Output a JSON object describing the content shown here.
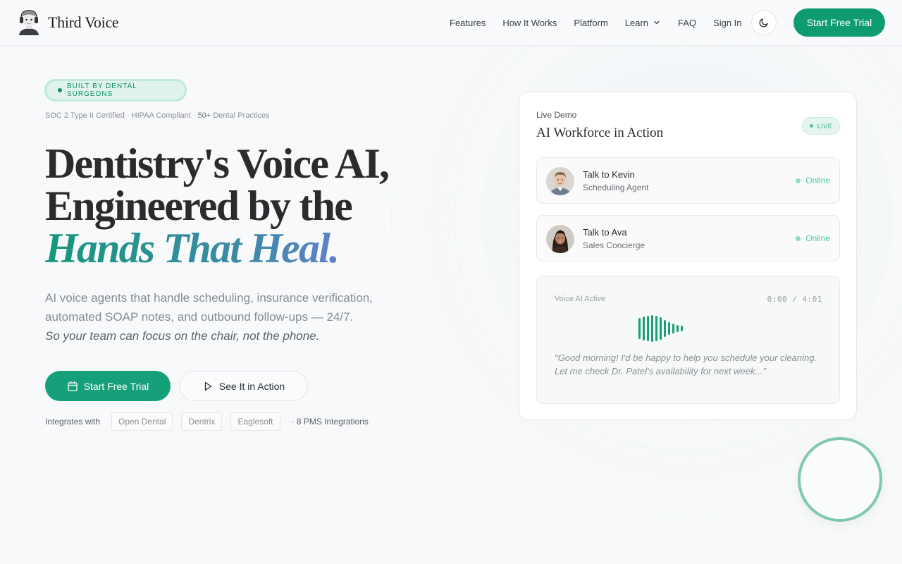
{
  "brand": {
    "name": "Third Voice"
  },
  "nav": {
    "items": [
      {
        "label": "Features",
        "has_dropdown": false
      },
      {
        "label": "How It Works",
        "has_dropdown": false
      },
      {
        "label": "Platform",
        "has_dropdown": false
      },
      {
        "label": "Learn",
        "has_dropdown": true
      },
      {
        "label": "FAQ",
        "has_dropdown": false
      },
      {
        "label": "Sign In",
        "has_dropdown": false
      }
    ],
    "theme_toggle_icon": "moon-icon",
    "cta_label": "Start Free Trial"
  },
  "hero": {
    "badge": "BUILT BY DENTAL SURGEONS",
    "certs_prefix": "SOC 2 Type II Certified · HIPAA Compliant · ",
    "certs_highlight": "50+",
    "certs_suffix": " Dental Practices",
    "headline_line1": "Dentistry's Voice AI,",
    "headline_line2": "Engineered by the",
    "headline_accent": "Hands That Heal.",
    "subtext": "AI voice agents that handle scheduling, insurance verification, automated SOAP notes, and outbound follow-ups — 24/7.",
    "subtext_italic": "So your team can focus on the chair, not the phone.",
    "primary_cta": "Start Free Trial",
    "secondary_cta": "See It in Action",
    "integrations_label": "Integrates with",
    "integrations": [
      "Open Dental",
      "Dentrix",
      "Eaglesoft"
    ],
    "integrations_more": "· 8 PMS Integrations"
  },
  "demo": {
    "kicker": "Live Demo",
    "title": "AI Workforce in Action",
    "live_badge": "LIVE",
    "agents": [
      {
        "name": "Talk to Kevin",
        "role": "Scheduling Agent",
        "status": "Online"
      },
      {
        "name": "Talk to Ava",
        "role": "Sales Concierge",
        "status": "Online"
      }
    ],
    "voice_label": "Voice AI Active",
    "voice_time": "0:00 / 4:01",
    "quote": "\"Good morning! I'd be happy to help you schedule your cleaning. Let me check Dr. Patel's availability for next week...\""
  },
  "colors": {
    "accent": "#0f9b72",
    "accent_light": "#e1f4ec",
    "online": "#4cc79c",
    "headline_gradient": [
      "#15987a",
      "#3d8aa6",
      "#6b7fd6",
      "#8a6fe0"
    ]
  }
}
